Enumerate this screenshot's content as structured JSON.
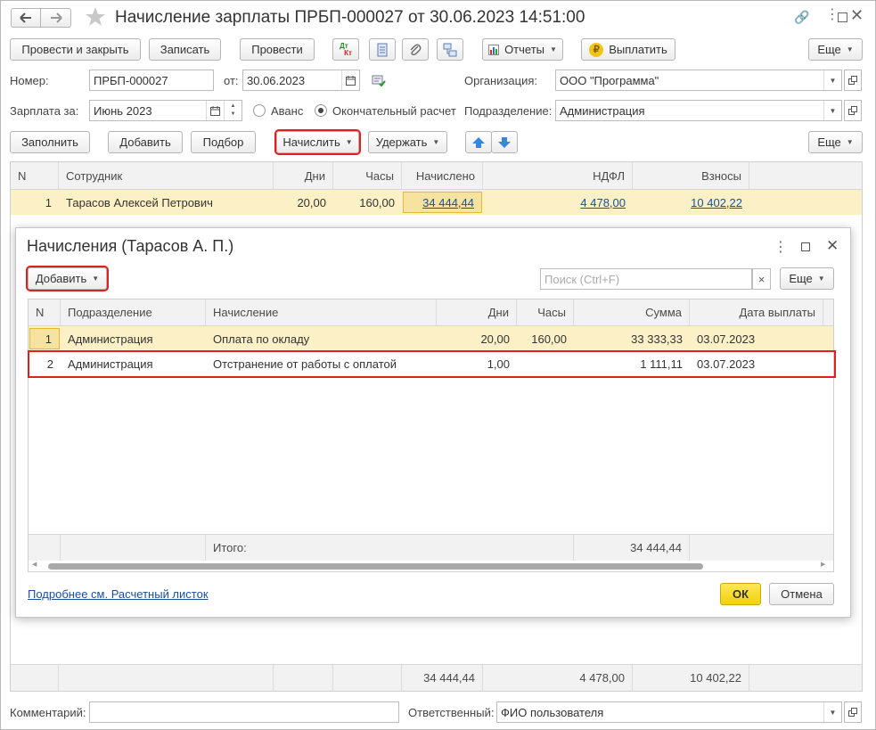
{
  "window": {
    "title": "Начисление зарплаты ПРБП-000027 от 30.06.2023 14:51:00"
  },
  "toolbar": {
    "post_close": "Провести и закрыть",
    "save": "Записать",
    "post": "Провести",
    "reports": "Отчеты",
    "pay": "Выплатить",
    "more": "Еще",
    "dt_kt_top": "Дт",
    "dt_kt_bottom": "Кт"
  },
  "form": {
    "number_label": "Номер:",
    "number_value": "ПРБП-000027",
    "date_label": "от:",
    "date_value": "30.06.2023",
    "org_label": "Организация:",
    "org_value": "ООО \"Программа\"",
    "salary_for_label": "Зарплата за:",
    "salary_for_value": "Июнь 2023",
    "radio_advance": "Аванс",
    "radio_final": "Окончательный расчет",
    "dept_label": "Подразделение:",
    "dept_value": "Администрация"
  },
  "toolbar2": {
    "fill": "Заполнить",
    "add": "Добавить",
    "select": "Подбор",
    "accrue": "Начислить",
    "withhold": "Удержать",
    "more": "Еще"
  },
  "main_table": {
    "columns": [
      "N",
      "Сотрудник",
      "Дни",
      "Часы",
      "Начислено",
      "НДФЛ",
      "Взносы"
    ],
    "rows": [
      {
        "n": "1",
        "employee": "Тарасов Алексей Петрович",
        "days": "20,00",
        "hours": "160,00",
        "accrued": "34 444,44",
        "ndfl": "4 478,00",
        "contrib": "10 402,22"
      }
    ],
    "totals": {
      "accrued": "34 444,44",
      "ndfl": "4 478,00",
      "contrib": "10 402,22"
    }
  },
  "dialog": {
    "title": "Начисления (Тарасов А. П.)",
    "add": "Добавить",
    "search_placeholder": "Поиск (Ctrl+F)",
    "search_clear": "×",
    "more": "Еще",
    "columns": [
      "N",
      "Подразделение",
      "Начисление",
      "Дни",
      "Часы",
      "Сумма",
      "Дата выплаты"
    ],
    "rows": [
      {
        "n": "1",
        "dept": "Администрация",
        "accrual": "Оплата по окладу",
        "days": "20,00",
        "hours": "160,00",
        "sum": "33 333,33",
        "date": "03.07.2023"
      },
      {
        "n": "2",
        "dept": "Администрация",
        "accrual": "Отстранение от работы с оплатой",
        "days": "1,00",
        "hours": "",
        "sum": "1 111,11",
        "date": "03.07.2023"
      }
    ],
    "total_label": "Итого:",
    "total_sum": "34 444,44",
    "footer_link": "Подробнее см. Расчетный листок",
    "ok": "ОК",
    "cancel": "Отмена"
  },
  "bottom": {
    "comment_label": "Комментарий:",
    "comment_value": "",
    "responsible_label": "Ответственный:",
    "responsible_value": "ФИО пользователя"
  },
  "colors": {
    "selected_row": "#fbf0c6",
    "highlight_red": "#e02020",
    "ok_yellow": "#f7dc1d",
    "link_blue": "#1b4f9c"
  }
}
